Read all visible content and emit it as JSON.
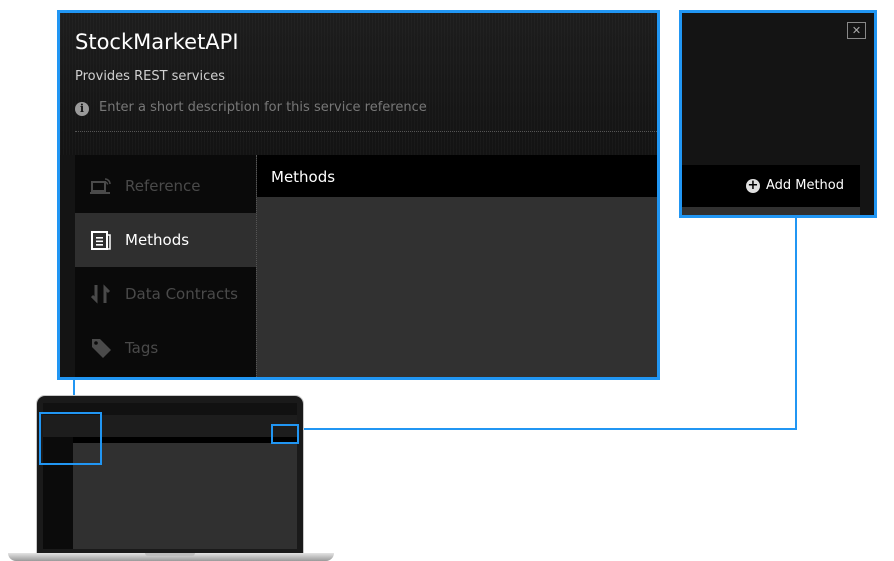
{
  "service": {
    "title": "StockMarketAPI",
    "subtitle": "Provides REST services",
    "description_placeholder": "Enter a short description for this service reference"
  },
  "nav": [
    {
      "label": "Reference",
      "icon": "reference-icon",
      "active": false
    },
    {
      "label": "Methods",
      "icon": "methods-icon",
      "active": true
    },
    {
      "label": "Data Contracts",
      "icon": "data-contracts-icon",
      "active": false
    },
    {
      "label": "Tags",
      "icon": "tag-icon",
      "active": false
    }
  ],
  "content": {
    "header": "Methods",
    "add_button": "Add Method"
  },
  "window": {
    "close_glyph": "✕"
  },
  "colors": {
    "highlight": "#2196f3",
    "panel_bg": "#141414",
    "active_nav": "#2f2f2f"
  }
}
